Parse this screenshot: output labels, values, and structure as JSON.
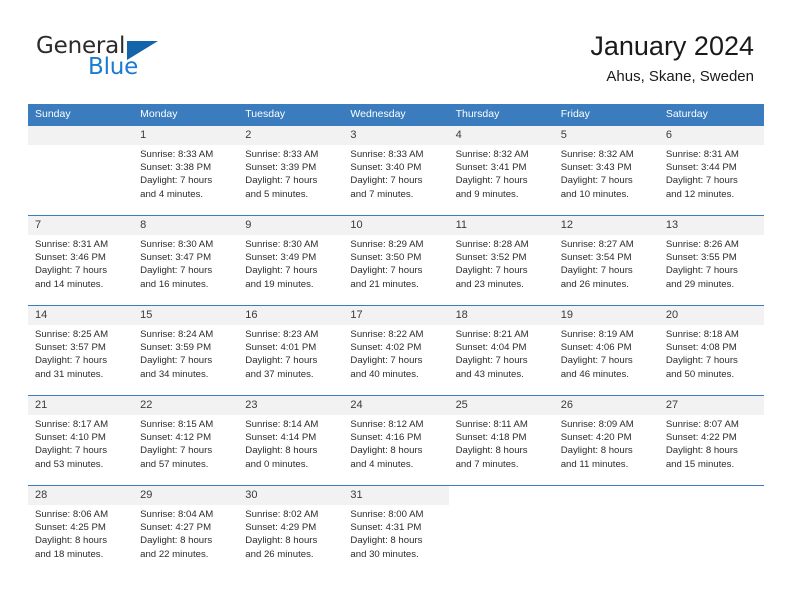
{
  "brand": {
    "name_part1": "General",
    "name_part2": "Blue"
  },
  "header": {
    "title": "January 2024",
    "location": "Ahus, Skane, Sweden"
  },
  "colors": {
    "header_blue": "#3a7cbe",
    "logo_blue": "#1b7ad1",
    "logo_flag": "#1464aa",
    "daynum_bg": "#f2f2f2"
  },
  "weekdays": [
    "Sunday",
    "Monday",
    "Tuesday",
    "Wednesday",
    "Thursday",
    "Friday",
    "Saturday"
  ],
  "weeks": [
    [
      {
        "day": "",
        "sunrise": "",
        "sunset": "",
        "daylight1": "",
        "daylight2": ""
      },
      {
        "day": "1",
        "sunrise": "Sunrise: 8:33 AM",
        "sunset": "Sunset: 3:38 PM",
        "daylight1": "Daylight: 7 hours",
        "daylight2": "and 4 minutes."
      },
      {
        "day": "2",
        "sunrise": "Sunrise: 8:33 AM",
        "sunset": "Sunset: 3:39 PM",
        "daylight1": "Daylight: 7 hours",
        "daylight2": "and 5 minutes."
      },
      {
        "day": "3",
        "sunrise": "Sunrise: 8:33 AM",
        "sunset": "Sunset: 3:40 PM",
        "daylight1": "Daylight: 7 hours",
        "daylight2": "and 7 minutes."
      },
      {
        "day": "4",
        "sunrise": "Sunrise: 8:32 AM",
        "sunset": "Sunset: 3:41 PM",
        "daylight1": "Daylight: 7 hours",
        "daylight2": "and 9 minutes."
      },
      {
        "day": "5",
        "sunrise": "Sunrise: 8:32 AM",
        "sunset": "Sunset: 3:43 PM",
        "daylight1": "Daylight: 7 hours",
        "daylight2": "and 10 minutes."
      },
      {
        "day": "6",
        "sunrise": "Sunrise: 8:31 AM",
        "sunset": "Sunset: 3:44 PM",
        "daylight1": "Daylight: 7 hours",
        "daylight2": "and 12 minutes."
      }
    ],
    [
      {
        "day": "7",
        "sunrise": "Sunrise: 8:31 AM",
        "sunset": "Sunset: 3:46 PM",
        "daylight1": "Daylight: 7 hours",
        "daylight2": "and 14 minutes."
      },
      {
        "day": "8",
        "sunrise": "Sunrise: 8:30 AM",
        "sunset": "Sunset: 3:47 PM",
        "daylight1": "Daylight: 7 hours",
        "daylight2": "and 16 minutes."
      },
      {
        "day": "9",
        "sunrise": "Sunrise: 8:30 AM",
        "sunset": "Sunset: 3:49 PM",
        "daylight1": "Daylight: 7 hours",
        "daylight2": "and 19 minutes."
      },
      {
        "day": "10",
        "sunrise": "Sunrise: 8:29 AM",
        "sunset": "Sunset: 3:50 PM",
        "daylight1": "Daylight: 7 hours",
        "daylight2": "and 21 minutes."
      },
      {
        "day": "11",
        "sunrise": "Sunrise: 8:28 AM",
        "sunset": "Sunset: 3:52 PM",
        "daylight1": "Daylight: 7 hours",
        "daylight2": "and 23 minutes."
      },
      {
        "day": "12",
        "sunrise": "Sunrise: 8:27 AM",
        "sunset": "Sunset: 3:54 PM",
        "daylight1": "Daylight: 7 hours",
        "daylight2": "and 26 minutes."
      },
      {
        "day": "13",
        "sunrise": "Sunrise: 8:26 AM",
        "sunset": "Sunset: 3:55 PM",
        "daylight1": "Daylight: 7 hours",
        "daylight2": "and 29 minutes."
      }
    ],
    [
      {
        "day": "14",
        "sunrise": "Sunrise: 8:25 AM",
        "sunset": "Sunset: 3:57 PM",
        "daylight1": "Daylight: 7 hours",
        "daylight2": "and 31 minutes."
      },
      {
        "day": "15",
        "sunrise": "Sunrise: 8:24 AM",
        "sunset": "Sunset: 3:59 PM",
        "daylight1": "Daylight: 7 hours",
        "daylight2": "and 34 minutes."
      },
      {
        "day": "16",
        "sunrise": "Sunrise: 8:23 AM",
        "sunset": "Sunset: 4:01 PM",
        "daylight1": "Daylight: 7 hours",
        "daylight2": "and 37 minutes."
      },
      {
        "day": "17",
        "sunrise": "Sunrise: 8:22 AM",
        "sunset": "Sunset: 4:02 PM",
        "daylight1": "Daylight: 7 hours",
        "daylight2": "and 40 minutes."
      },
      {
        "day": "18",
        "sunrise": "Sunrise: 8:21 AM",
        "sunset": "Sunset: 4:04 PM",
        "daylight1": "Daylight: 7 hours",
        "daylight2": "and 43 minutes."
      },
      {
        "day": "19",
        "sunrise": "Sunrise: 8:19 AM",
        "sunset": "Sunset: 4:06 PM",
        "daylight1": "Daylight: 7 hours",
        "daylight2": "and 46 minutes."
      },
      {
        "day": "20",
        "sunrise": "Sunrise: 8:18 AM",
        "sunset": "Sunset: 4:08 PM",
        "daylight1": "Daylight: 7 hours",
        "daylight2": "and 50 minutes."
      }
    ],
    [
      {
        "day": "21",
        "sunrise": "Sunrise: 8:17 AM",
        "sunset": "Sunset: 4:10 PM",
        "daylight1": "Daylight: 7 hours",
        "daylight2": "and 53 minutes."
      },
      {
        "day": "22",
        "sunrise": "Sunrise: 8:15 AM",
        "sunset": "Sunset: 4:12 PM",
        "daylight1": "Daylight: 7 hours",
        "daylight2": "and 57 minutes."
      },
      {
        "day": "23",
        "sunrise": "Sunrise: 8:14 AM",
        "sunset": "Sunset: 4:14 PM",
        "daylight1": "Daylight: 8 hours",
        "daylight2": "and 0 minutes."
      },
      {
        "day": "24",
        "sunrise": "Sunrise: 8:12 AM",
        "sunset": "Sunset: 4:16 PM",
        "daylight1": "Daylight: 8 hours",
        "daylight2": "and 4 minutes."
      },
      {
        "day": "25",
        "sunrise": "Sunrise: 8:11 AM",
        "sunset": "Sunset: 4:18 PM",
        "daylight1": "Daylight: 8 hours",
        "daylight2": "and 7 minutes."
      },
      {
        "day": "26",
        "sunrise": "Sunrise: 8:09 AM",
        "sunset": "Sunset: 4:20 PM",
        "daylight1": "Daylight: 8 hours",
        "daylight2": "and 11 minutes."
      },
      {
        "day": "27",
        "sunrise": "Sunrise: 8:07 AM",
        "sunset": "Sunset: 4:22 PM",
        "daylight1": "Daylight: 8 hours",
        "daylight2": "and 15 minutes."
      }
    ],
    [
      {
        "day": "28",
        "sunrise": "Sunrise: 8:06 AM",
        "sunset": "Sunset: 4:25 PM",
        "daylight1": "Daylight: 8 hours",
        "daylight2": "and 18 minutes."
      },
      {
        "day": "29",
        "sunrise": "Sunrise: 8:04 AM",
        "sunset": "Sunset: 4:27 PM",
        "daylight1": "Daylight: 8 hours",
        "daylight2": "and 22 minutes."
      },
      {
        "day": "30",
        "sunrise": "Sunrise: 8:02 AM",
        "sunset": "Sunset: 4:29 PM",
        "daylight1": "Daylight: 8 hours",
        "daylight2": "and 26 minutes."
      },
      {
        "day": "31",
        "sunrise": "Sunrise: 8:00 AM",
        "sunset": "Sunset: 4:31 PM",
        "daylight1": "Daylight: 8 hours",
        "daylight2": "and 30 minutes."
      },
      {
        "day": "",
        "sunrise": "",
        "sunset": "",
        "daylight1": "",
        "daylight2": ""
      },
      {
        "day": "",
        "sunrise": "",
        "sunset": "",
        "daylight1": "",
        "daylight2": ""
      },
      {
        "day": "",
        "sunrise": "",
        "sunset": "",
        "daylight1": "",
        "daylight2": ""
      }
    ]
  ]
}
